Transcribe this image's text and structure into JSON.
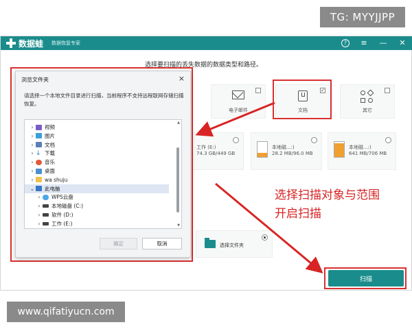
{
  "watermark_top": "TG: MYYJJPP",
  "watermark_bottom": "www.qifatiyucn.com",
  "app": {
    "name": "数据蛙",
    "subtitle": "数据恢复专家",
    "instruction": "选择要扫描的丢失数据的数据类型和路径。",
    "titlebar_icons": [
      "help-icon",
      "menu-icon",
      "minimize-icon",
      "close-icon"
    ]
  },
  "file_types": [
    {
      "label": "电子邮件",
      "icon": "envelope-icon",
      "checked": false
    },
    {
      "label": "文档",
      "icon": "document-icon",
      "checked": true
    },
    {
      "label": "其它",
      "icon": "other-icon",
      "checked": false
    }
  ],
  "drives": [
    {
      "name": "工作 (E:)",
      "size": "74.3 GB/449 GB",
      "fill": 0.17
    },
    {
      "name": "本地磁...:)",
      "size": "28.2 MB/96.0 MB",
      "fill": 0.29
    },
    {
      "name": "本地磁...:)",
      "size": "641 MB/706 MB",
      "fill": 0.91
    }
  ],
  "select_folder_label": "选择文件夹",
  "annotation_lines": [
    "选择扫描对象与范围",
    "开启扫描"
  ],
  "scan_button_label": "扫描",
  "dialog": {
    "title": "浏览文件夹",
    "close": "×",
    "description": "请选择一个本地文件目录进行扫描，当前程序不支持远程联网存储扫描恢复。",
    "tree": [
      {
        "label": "视频",
        "icon": "video-icon",
        "indent": 0,
        "selected": false,
        "expander": "›"
      },
      {
        "label": "图片",
        "icon": "picture-icon",
        "indent": 0,
        "selected": false,
        "expander": "›"
      },
      {
        "label": "文档",
        "icon": "document-icon",
        "indent": 0,
        "selected": false,
        "expander": "›"
      },
      {
        "label": "下载",
        "icon": "download-icon",
        "indent": 0,
        "selected": false,
        "expander": "›"
      },
      {
        "label": "音乐",
        "icon": "music-icon",
        "indent": 0,
        "selected": false,
        "expander": "›"
      },
      {
        "label": "桌面",
        "icon": "desktop-icon",
        "indent": 0,
        "selected": false,
        "expander": "›"
      },
      {
        "label": "wa shuju",
        "icon": "folder-icon",
        "indent": 0,
        "selected": false,
        "expander": "›"
      },
      {
        "label": "此电脑",
        "icon": "computer-icon",
        "indent": 0,
        "selected": true,
        "expander": "⌄"
      },
      {
        "label": "WPS云盘",
        "icon": "cloud-icon",
        "indent": 1,
        "selected": false,
        "expander": "›"
      },
      {
        "label": "本地磁盘 (C:)",
        "icon": "drive-icon",
        "indent": 1,
        "selected": false,
        "expander": "›"
      },
      {
        "label": "软件 (D:)",
        "icon": "drive-icon",
        "indent": 1,
        "selected": false,
        "expander": "›"
      },
      {
        "label": "工作 (E:)",
        "icon": "drive-icon",
        "indent": 1,
        "selected": false,
        "expander": "›"
      }
    ],
    "ok_label": "确定",
    "cancel_label": "取消"
  }
}
